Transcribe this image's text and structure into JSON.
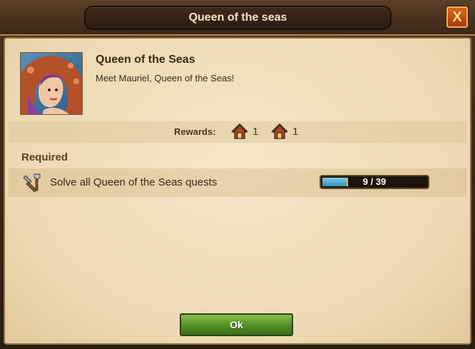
{
  "window": {
    "title": "Queen of the seas",
    "close_label": "X"
  },
  "quest": {
    "title": "Queen of the Seas",
    "description": "Meet Mauriel, Queen of the Seas!"
  },
  "rewards": {
    "label": "Rewards:",
    "items": [
      {
        "icon": "reward-building-icon",
        "count": "1"
      },
      {
        "icon": "reward-building-icon",
        "count": "1"
      }
    ]
  },
  "required": {
    "header": "Required",
    "items": [
      {
        "icon": "hammer-tools-icon",
        "text": "Solve all Queen of the Seas quests",
        "progress_text": "9 / 39",
        "progress_fraction": 0.23
      }
    ]
  },
  "footer": {
    "ok_label": "Ok"
  },
  "colors": {
    "parchment": "#ecd9b3",
    "ok_green": "#4c8a22",
    "close_orange": "#c14d14",
    "progress_blue": "#2e90b8"
  }
}
